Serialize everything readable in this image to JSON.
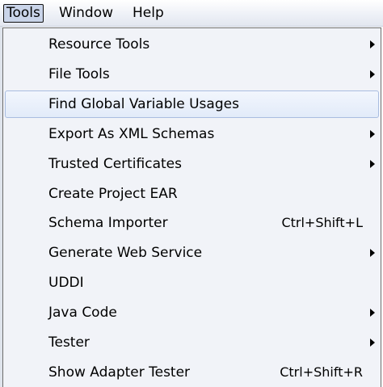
{
  "menubar": {
    "items": [
      {
        "label": "Tools",
        "active": true
      },
      {
        "label": "Window",
        "active": false
      },
      {
        "label": "Help",
        "active": false
      }
    ]
  },
  "dropdown": {
    "items": [
      {
        "label": "Resource Tools",
        "shortcut": "",
        "submenu": true,
        "hover": false,
        "arrow_icon": "chevron-right-icon"
      },
      {
        "label": "File Tools",
        "shortcut": "",
        "submenu": true,
        "hover": false,
        "arrow_icon": "chevron-right-icon"
      },
      {
        "label": "Find Global Variable Usages",
        "shortcut": "",
        "submenu": false,
        "hover": true
      },
      {
        "label": "Export As XML Schemas",
        "shortcut": "",
        "submenu": true,
        "hover": false,
        "arrow_icon": "chevron-right-icon"
      },
      {
        "label": "Trusted Certificates",
        "shortcut": "",
        "submenu": true,
        "hover": false,
        "arrow_icon": "chevron-right-icon"
      },
      {
        "label": "Create Project EAR",
        "shortcut": "",
        "submenu": false,
        "hover": false
      },
      {
        "label": "Schema Importer",
        "shortcut": "Ctrl+Shift+L",
        "submenu": false,
        "hover": false
      },
      {
        "label": "Generate Web Service",
        "shortcut": "",
        "submenu": true,
        "hover": false,
        "arrow_icon": "chevron-right-icon"
      },
      {
        "label": "UDDI",
        "shortcut": "",
        "submenu": false,
        "hover": false
      },
      {
        "label": "Java Code",
        "shortcut": "",
        "submenu": true,
        "hover": false,
        "arrow_icon": "chevron-right-icon"
      },
      {
        "label": "Tester",
        "shortcut": "",
        "submenu": true,
        "hover": false,
        "arrow_icon": "chevron-right-icon"
      },
      {
        "label": "Show Adapter Tester",
        "shortcut": "Ctrl+Shift+R",
        "submenu": false,
        "hover": false
      }
    ]
  },
  "colors": {
    "menu_background": "#f1f3f8",
    "hover_border": "#a9bde0",
    "active_top_item": "#c9d4e9"
  }
}
